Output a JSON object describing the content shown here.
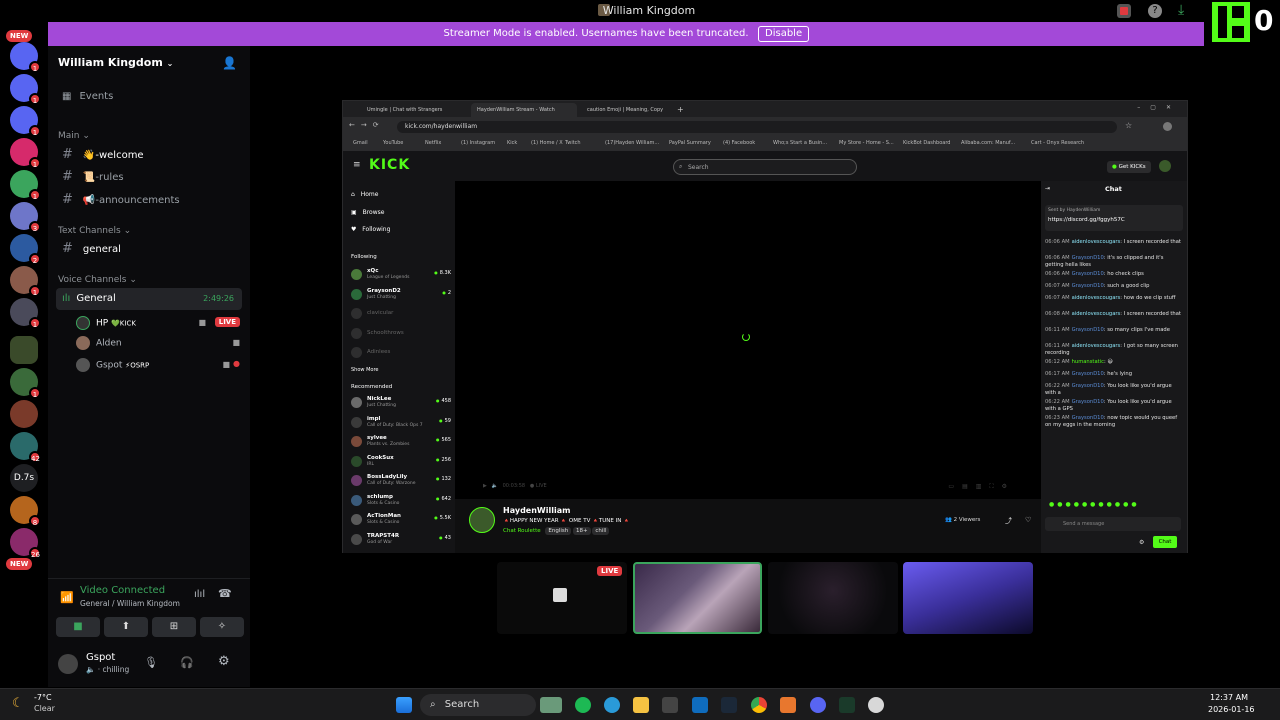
{
  "window": {
    "title": "William Kingdom"
  },
  "banner": {
    "text": "Streamer Mode is enabled. Usernames have been truncated.",
    "button": "Disable"
  },
  "overlay": {
    "count": "0",
    "color": "#53fc18"
  },
  "rail": {
    "new_top": "NEW",
    "new_bottom": "NEW",
    "d7s": "D.7s",
    "badges": [
      "1",
      "1",
      "1",
      "1",
      "1",
      "3",
      "2",
      "1",
      "1",
      "1",
      "42",
      "8",
      "26"
    ]
  },
  "sidebar": {
    "server_name": "William Kingdom",
    "events": "Events",
    "cat_main": "Main",
    "channels_main": [
      {
        "emoji": "👋",
        "label": "-welcome"
      },
      {
        "emoji": "📜",
        "label": "-rules"
      },
      {
        "emoji": "📢",
        "label": "-announcements"
      }
    ],
    "cat_text": "Text Channels",
    "text_channels": [
      "general"
    ],
    "cat_voice": "Voice Channels",
    "voice_channel": "General",
    "voice_timer": "2:49:26",
    "voice_users": [
      {
        "name": "HP",
        "tag": "💚KICK",
        "live": "LIVE"
      },
      {
        "name": "Alden",
        "tag": ""
      },
      {
        "name": "Gspot",
        "tag": "⚡OSRP"
      }
    ],
    "vc_status": "Video Connected",
    "vc_location": "General / William Kingdom",
    "user_name": "Gspot",
    "user_status": "chilling"
  },
  "browser": {
    "tabs": [
      "Umingle | Chat with Strangers",
      "HaydenWilliam Stream - Watch",
      "caution Emoji | Meaning, Copy",
      "+"
    ],
    "url": "kick.com/haydenwilliam",
    "bookmarks": [
      "Gmail",
      "YouTube",
      "Netflix",
      "(1) Instagram",
      "Kick",
      "(1) Home / X",
      "Twitch",
      "(17)Hayden William...",
      "PayPal Summary",
      "(4) Facebook",
      "Who;s Start a Busin...",
      "My Store - Home - S...",
      "KickBot Dashboard",
      "Alibaba.com: Manuf...",
      "Cart - Onyx Research"
    ]
  },
  "kick": {
    "logo": "KICK",
    "search_placeholder": "Search",
    "get_kicks": "Get KICKs",
    "nav": [
      "Home",
      "Browse",
      "Following"
    ],
    "following_title": "Following",
    "following": [
      {
        "name": "xQc",
        "game": "League of Legends",
        "count": "8.3K"
      },
      {
        "name": "GraysonD2",
        "game": "Just Chatting",
        "count": "2"
      },
      {
        "name": "clavicular",
        "game": "",
        "count": ""
      },
      {
        "name": "Schoolthrows",
        "game": "",
        "count": ""
      },
      {
        "name": "Adinlees",
        "game": "",
        "count": ""
      }
    ],
    "show_more": "Show More",
    "recommended_title": "Recommended",
    "recommended": [
      {
        "name": "NickLee",
        "game": "Just Chatting",
        "count": "458"
      },
      {
        "name": "impl",
        "game": "Call of Duty: Black Ops 7",
        "count": "59"
      },
      {
        "name": "sylvee",
        "game": "Plants vs. Zombies",
        "count": "565"
      },
      {
        "name": "CookSux",
        "game": "IRL",
        "count": "256"
      },
      {
        "name": "BossLadyLily",
        "game": "Call of Duty: Warzone",
        "count": "132"
      },
      {
        "name": "schlump",
        "game": "Slots & Casino",
        "count": "642"
      },
      {
        "name": "AcTionMan",
        "game": "Slots & Casino",
        "count": "5.5K"
      },
      {
        "name": "TRAPST4R",
        "game": "God of War",
        "count": "43"
      }
    ],
    "player_time": "00:03:58",
    "player_live": "LIVE",
    "streamer": "HaydenWilliam",
    "stream_title": "🔺HAPPY NEW YEAR 🔺 OME TV 🔺TUNE IN 🔺",
    "category": "Chat Roulette",
    "tags": [
      "English",
      "18+",
      "chill"
    ],
    "viewers": "2 Viewers",
    "chat_title": "Chat",
    "pinned_by": "Sent by",
    "pinned_user": "HaydenWilliam",
    "pinned_link": "https://discord.gg/fggyh57C",
    "chat": [
      {
        "time": "06:06 AM",
        "user": "aidenlovescougars",
        "cls": "u1",
        "msg": ": I screen recorded that"
      },
      {
        "time": "06:06 AM",
        "user": "GraysonD10",
        "cls": "u2",
        "msg": ": it's so clipped and it's getting hella likes"
      },
      {
        "time": "06:06 AM",
        "user": "GraysonD10",
        "cls": "u2",
        "msg": ": ho check clips"
      },
      {
        "time": "06:07 AM",
        "user": "GraysonD10",
        "cls": "u2",
        "msg": ": such a good clip"
      },
      {
        "time": "06:07 AM",
        "user": "aidenlovescougars",
        "cls": "u1",
        "msg": ": how do we clip stuff"
      },
      {
        "time": "06:08 AM",
        "user": "aidenlovescougars",
        "cls": "u1",
        "msg": ": I screen recorded that"
      },
      {
        "time": "06:11 AM",
        "user": "GraysonD10",
        "cls": "u2",
        "msg": ": so many clips I've made"
      },
      {
        "time": "06:11 AM",
        "user": "aidenlovescougars",
        "cls": "u1",
        "msg": ": I got so many screen recording"
      },
      {
        "time": "06:12 AM",
        "user": "humanstatic",
        "cls": "u3",
        "msg": ": 😄"
      },
      {
        "time": "06:17 AM",
        "user": "GraysonD10",
        "cls": "u2",
        "msg": ": he's lying"
      },
      {
        "time": "06:22 AM",
        "user": "GraysonD10",
        "cls": "u2",
        "msg": ": You look like you'd argue with a"
      },
      {
        "time": "06:22 AM",
        "user": "GraysonD10",
        "cls": "u2",
        "msg": ": You look like you'd argue with a GPS"
      },
      {
        "time": "06:23 AM",
        "user": "GraysonD10",
        "cls": "u2",
        "msg": ": now topic would you queef on my eggs in the morning"
      }
    ],
    "send_placeholder": "Send a message",
    "chat_button": "Chat"
  },
  "cams": {
    "live": "LIVE"
  },
  "taskbar": {
    "weather_temp": "-7°C",
    "weather_desc": "Clear",
    "search": "Search",
    "time": "12:37 AM",
    "date": "2026-01-16"
  }
}
